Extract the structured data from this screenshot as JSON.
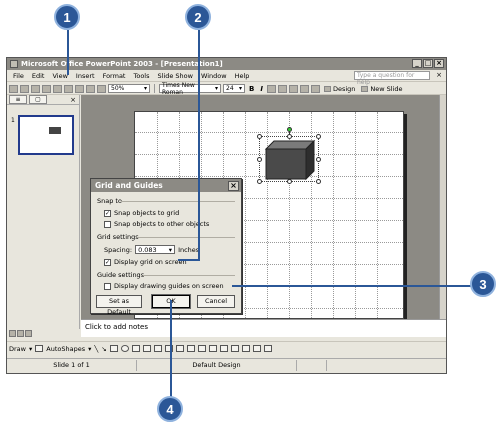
{
  "window": {
    "title": "Microsoft Office PowerPoint 2003 - [Presentation1]",
    "controls": [
      "_",
      "□",
      "×"
    ]
  },
  "menu": {
    "items": [
      "File",
      "Edit",
      "View",
      "Insert",
      "Format",
      "Tools",
      "Slide Show",
      "Window",
      "Help"
    ],
    "help_placeholder": "Type a question for help"
  },
  "toolbar": {
    "zoom": "50%",
    "font": "Times New Roman",
    "font_size": "24",
    "bold": "B",
    "italic": "I",
    "design": "Design",
    "new_slide": "New Slide"
  },
  "slides_pane": {
    "tab_outline": "≡",
    "tab_slides": "▢",
    "close": "×",
    "thumb_number": "1"
  },
  "notes_placeholder": "Click to add notes",
  "drawing": {
    "draw": "Draw",
    "autoshapes": "AutoShapes"
  },
  "status": {
    "slide": "Slide 1 of 1",
    "design": "Default Design"
  },
  "dialog": {
    "title": "Grid and Guides",
    "close": "×",
    "snap_heading": "Snap to",
    "snap_grid": "Snap objects to grid",
    "snap_objects": "Snap objects to other objects",
    "grid_heading": "Grid settings",
    "spacing_label": "Spacing:",
    "spacing_value": "0.083",
    "spacing_unit": "Inches",
    "display_grid": "Display grid on screen",
    "guide_heading": "Guide settings",
    "display_guides": "Display drawing guides on screen",
    "set_default": "Set as Default",
    "ok": "OK",
    "cancel": "Cancel",
    "checked": {
      "snap_grid": true,
      "snap_objects": false,
      "display_grid": true,
      "display_guides": false
    }
  },
  "callouts": [
    "1",
    "2",
    "3",
    "4"
  ],
  "colors": {
    "callout": "#2b5797",
    "titlebar": "#8c8a84",
    "cube_front": "#4a4a4a"
  }
}
